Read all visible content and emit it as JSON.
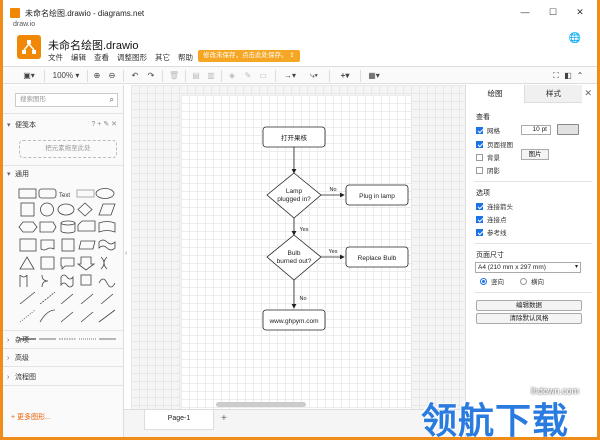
{
  "window": {
    "title": "未命名绘图.drawio - diagrams.net",
    "subtitle": "draw.io",
    "minimize": "—",
    "maximize": "☐",
    "close": "✕"
  },
  "header": {
    "doc_title": "未命名绘图.drawio",
    "menu": [
      "文件",
      "编辑",
      "查看",
      "调整图形",
      "其它",
      "帮助"
    ],
    "save_warning": "修改未保存，点击此处保存。",
    "globe": "🌐"
  },
  "toolbar": {
    "zoom": "100%"
  },
  "sidebar": {
    "search_placeholder": "搜索图形",
    "scratchpad": "便笺本",
    "scratchpad_tools": "? + ✎ ✕",
    "drop_hint": "把元素拖至此处",
    "general": "通用",
    "sections": [
      "杂项",
      "高级",
      "流程图"
    ],
    "more_shapes": "+ 更多图形..."
  },
  "diagram": {
    "start": "打开果核",
    "decision1": "Lamp plugged in?",
    "decision1_lines": [
      "Lamp",
      "plugged in?"
    ],
    "action1": "Plug in lamp",
    "decision2_lines": [
      "Bulb",
      "burned out?"
    ],
    "action2": "Replace Bulb",
    "end": "www.ghpym.com",
    "label_no1": "No",
    "label_yes1": "Yes",
    "label_yes2": "Yes",
    "label_no2": "No"
  },
  "bottom": {
    "page_tab": "Page-1",
    "add_page": "+"
  },
  "panel": {
    "tab_diagram": "绘图",
    "tab_style": "样式",
    "close": "✕",
    "view_title": "查看",
    "grid": "网格",
    "grid_size": "10 pt",
    "page_view": "页面视图",
    "background": "背景",
    "image_button": "图片",
    "shadow": "阴影",
    "options_title": "选项",
    "connection_arrows": "连接箭头",
    "connection_points": "连接点",
    "guides": "参考线",
    "paper_size_title": "页面尺寸",
    "paper_size": "A4 (210 mm x 297 mm)",
    "portrait": "竖向",
    "landscape": "横向",
    "edit_data": "编辑数据",
    "clear_default_style": "清除默认风格"
  },
  "watermark": {
    "url": "lhdown.com",
    "brand": "领航下载"
  },
  "colors": {
    "accent": "#f08705",
    "border": "#f08c1a",
    "watermark_blue": "#2a7be0"
  }
}
